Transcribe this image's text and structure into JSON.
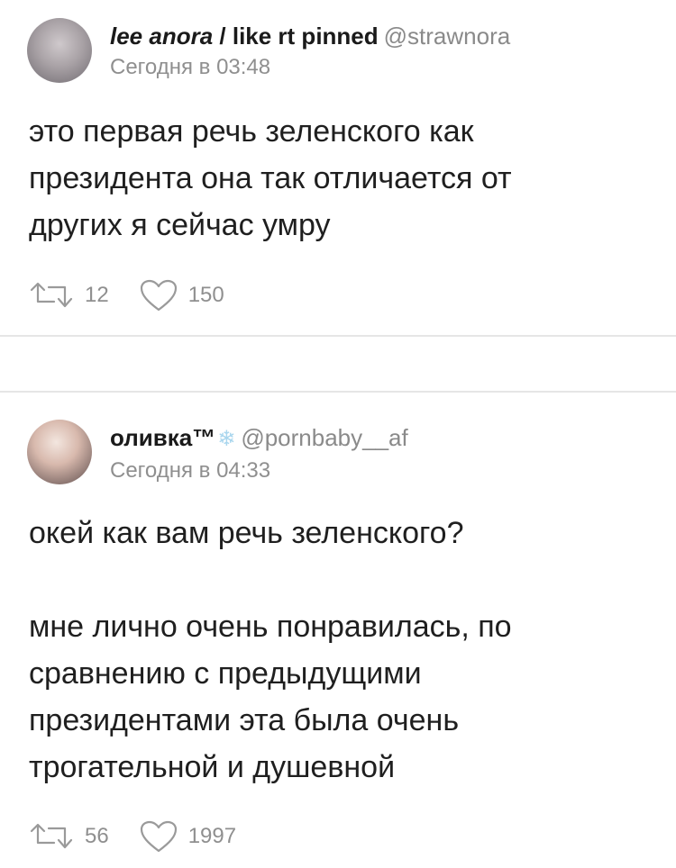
{
  "tweets": [
    {
      "display_name_italic": "lee anora",
      "display_name_rest": " / like rt pinned",
      "handle": "@strawnora",
      "time": "Сегодня в 03:48",
      "paragraphs": [
        "это первая речь зеленского как\nпрезидента она так отличается от\nдругих я сейчас умру"
      ],
      "retweets": "12",
      "likes": "150"
    },
    {
      "display_name": "оливка™",
      "emoji": "❄",
      "handle": "@pornbaby__af",
      "time": "Сегодня в 04:33",
      "paragraphs": [
        "окей как вам речь зеленского?",
        "мне лично очень понравилась, по\nсравнению с предыдущими\nпрезидентами эта была очень\nтрогательной и душевной"
      ],
      "retweets": "56",
      "likes": "1997"
    }
  ],
  "colors": {
    "text": "#1f1f1f",
    "muted": "#8f8f8f",
    "divider": "#e6e6e6",
    "background": "#ffffff"
  },
  "icons": [
    "retweet-icon",
    "heart-icon",
    "snowflake-emoji"
  ]
}
